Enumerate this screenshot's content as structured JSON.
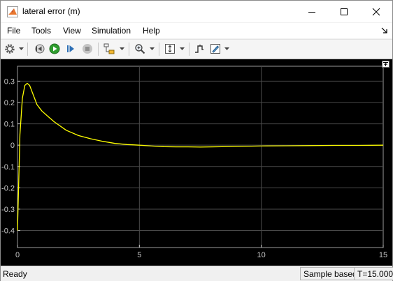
{
  "window": {
    "title": "lateral error (m)"
  },
  "menu": {
    "items": [
      "File",
      "Tools",
      "View",
      "Simulation",
      "Help"
    ]
  },
  "toolbar": {
    "icons": [
      "settings-icon",
      "step-back-icon",
      "run-icon",
      "step-forward-icon",
      "stop-icon",
      "highlight-icon",
      "zoom-icon",
      "autoscale-icon",
      "triggers-icon",
      "cursor-measure-icon"
    ]
  },
  "chart_data": {
    "type": "line",
    "title": "",
    "xlabel": "",
    "ylabel": "",
    "xlim": [
      0,
      15
    ],
    "ylim": [
      -0.48,
      0.37
    ],
    "xticks": [
      0,
      5,
      10,
      15
    ],
    "yticks": [
      -0.4,
      -0.3,
      -0.2,
      -0.1,
      0,
      0.1,
      0.2,
      0.3
    ],
    "yticklabels": [
      "-0.4",
      "-0.3",
      "-0.2",
      "-0.1",
      "0",
      "0.1",
      "0.2",
      "0.3"
    ],
    "grid": true,
    "background": "#000000",
    "series": [
      {
        "color": "#ffff00",
        "x": [
          0,
          0.1,
          0.2,
          0.3,
          0.4,
          0.5,
          0.6,
          0.7,
          0.8,
          1.0,
          1.2,
          1.5,
          2.0,
          2.5,
          3.0,
          3.5,
          4.0,
          4.5,
          5.0,
          5.5,
          6.0,
          6.5,
          7.0,
          7.5,
          8.0,
          9.0,
          10.0,
          11.0,
          12.0,
          13.0,
          14.0,
          15.0
        ],
        "y": [
          -0.4,
          0.05,
          0.22,
          0.28,
          0.29,
          0.28,
          0.25,
          0.22,
          0.19,
          0.16,
          0.14,
          0.11,
          0.07,
          0.045,
          0.03,
          0.018,
          0.008,
          0.003,
          0.0,
          -0.004,
          -0.007,
          -0.008,
          -0.008,
          -0.009,
          -0.008,
          -0.006,
          -0.004,
          -0.003,
          -0.002,
          -0.001,
          -0.001,
          0.0
        ]
      }
    ]
  },
  "status": {
    "text": "Ready",
    "sample_mode": "Sample based",
    "time": "T=15.000"
  }
}
